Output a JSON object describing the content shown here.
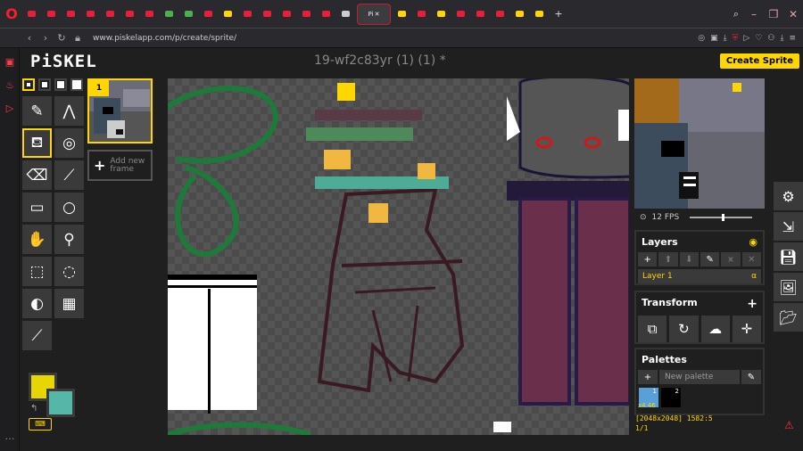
{
  "browser": {
    "active_tab_label": "Pi",
    "url": "www.piskelapp.com/p/create/sprite/",
    "tab_colors": [
      "#e81e3c",
      "#e81e3c",
      "#e81e3c",
      "#e81e3c",
      "#e81e3c",
      "#e81e3c",
      "#e81e3c",
      "#4caf50",
      "#4caf50",
      "#e81e3c",
      "#ffd700",
      "#e81e3c",
      "#e81e3c",
      "#e81e3c",
      "#e81e3c",
      "#e81e3c",
      "#cccccc",
      "#ffd700",
      "#e81e3c",
      "#ffd700",
      "#e81e3c",
      "#e81e3c",
      "#e81e3c",
      "#ffd700",
      "#ffd700"
    ]
  },
  "app": {
    "logo": "PiSKEL",
    "doc_title": "19-wf2c83yr (1) (1) *",
    "create_button": "Create Sprite"
  },
  "frames": {
    "current_frame_number": "1",
    "add_frame_label_1": "Add new",
    "add_frame_label_2": "frame"
  },
  "colors": {
    "primary": "#e8d600",
    "secondary": "#55b7a8"
  },
  "preview": {
    "fps_label": "12 FPS",
    "fps": 12
  },
  "layers": {
    "title": "Layers",
    "layer_name": "Layer 1",
    "alpha_label": "α"
  },
  "transform": {
    "title": "Transform"
  },
  "palettes": {
    "title": "Palettes",
    "select_value": "New palette",
    "swatch1_num": "1",
    "swatch2_num": "2",
    "swatch1_count": "x4.46"
  },
  "status": {
    "dimensions_and_cursor": "[2048x2048] 1582:5",
    "frame_counter": "1/1"
  }
}
